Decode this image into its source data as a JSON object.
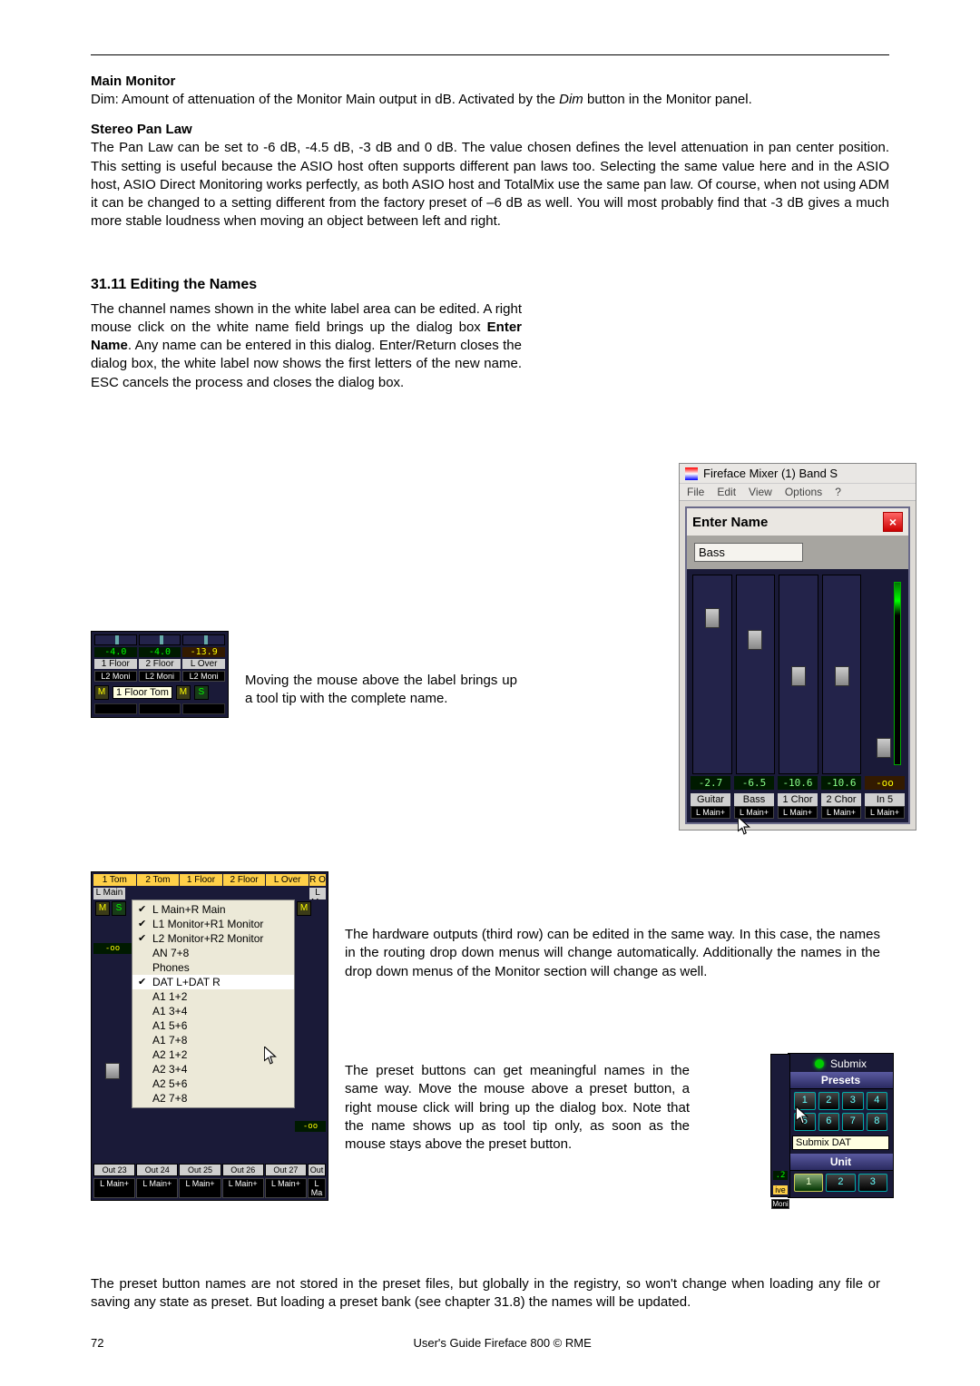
{
  "headings": {
    "main_monitor": "Main Monitor",
    "stereo_pan_law": "Stereo Pan Law",
    "editing_names": "31.11 Editing the Names"
  },
  "paragraphs": {
    "dim_pre": "Dim: Amount of attenuation of the Monitor Main output in dB. Activated by the ",
    "dim_italic": "Dim",
    "dim_post": " button in the Monitor panel.",
    "pan_law": "The Pan Law can be set to -6 dB, -4.5 dB, -3 dB and 0 dB. The value chosen defines the level attenuation in pan center position. This setting is useful because the ASIO host often supports different pan laws too. Selecting the same value here and in the ASIO host, ASIO Direct Monitoring works perfectly, as both ASIO host and TotalMix use the same pan law. Of course, when not using ADM it can be changed to a setting different from the factory preset of –6 dB as well. You will most probably find that -3 dB gives a much more stable loudness when moving an object between left and right.",
    "edit_pre": "The channel names shown in the white label area can be edited. A right mouse click on the white name field brings up the dialog box ",
    "edit_bold": "Enter Name",
    "edit_post": ". Any name can be entered in this dialog. Enter/Return closes the dialog box, the white label now shows the first letters of the new name. ESC cancels the process and closes the dialog box.",
    "tooltip": "Moving the mouse above the label brings up a tool tip with the complete name.",
    "routing": "The hardware outputs (third row) can be edited in the same way. In this case, the names in the routing drop down menus will change automatically. Additionally the names in the drop down menus of the Monitor section will change as well.",
    "presets": "The preset buttons can get meaningful names in the same way. Move the mouse above a preset button, a right mouse click will bring up the dialog box. Note that the name shows up as tool tip only, as soon as the mouse stays above the preset button.",
    "final": "The preset button names are not stored in the preset files, but globally in the registry, so won't change when loading any file or saving any state as preset. But loading a preset bank (see chapter 31.8) the names will be updated."
  },
  "enter_name_dialog": {
    "title": "Fireface Mixer (1) Band S",
    "menus": [
      "File",
      "Edit",
      "View",
      "Options",
      "?"
    ],
    "panel_title": "Enter Name",
    "input_value": "Bass",
    "db_values": [
      "-2.7",
      "-6.5",
      "-10.6",
      "-10.6",
      "-oo"
    ],
    "names": [
      "Guitar",
      "Bass",
      "1 Chor",
      "2 Chor",
      "In 5"
    ],
    "routes": [
      "L Main+",
      "L Main+",
      "L Main+",
      "L Main+",
      "L Main+"
    ]
  },
  "tooltip_fig": {
    "db_values": [
      "-4.0",
      "-4.0",
      "-13.9"
    ],
    "names": [
      "1 Floor",
      "2 Floor",
      "L Over"
    ],
    "routes": [
      "L2 Moni",
      "L2 Moni",
      "L2 Moni"
    ],
    "m": "M",
    "s": "S",
    "tip": "1 Floor Tom"
  },
  "routing_fig": {
    "top_labels": [
      "1 Tom",
      "2 Tom",
      "1 Floor",
      "2 Floor",
      "L Over",
      "R O"
    ],
    "l_main": "L Main",
    "ms": {
      "m": "M",
      "s": "S"
    },
    "oo": "-oo",
    "menu": [
      {
        "label": "L Main+R Main",
        "checked": true
      },
      {
        "label": "L1 Monitor+R1 Monitor",
        "checked": true
      },
      {
        "label": "L2 Monitor+R2 Monitor",
        "checked": true
      },
      {
        "label": "AN 7+8",
        "checked": false
      },
      {
        "label": "Phones",
        "checked": false
      },
      {
        "label": "DAT L+DAT R",
        "checked": true,
        "selected": true
      },
      {
        "label": "A1 1+2",
        "checked": false
      },
      {
        "label": "A1 3+4",
        "checked": false
      },
      {
        "label": "A1 5+6",
        "checked": false
      },
      {
        "label": "A1 7+8",
        "checked": false
      },
      {
        "label": "A2 1+2",
        "checked": false
      },
      {
        "label": "A2 3+4",
        "checked": false
      },
      {
        "label": "A2 5+6",
        "checked": false
      },
      {
        "label": "A2 7+8",
        "checked": false
      }
    ],
    "bottom_labels": [
      "Out 23",
      "Out 24",
      "Out 25",
      "Out 26",
      "Out 27",
      "Out"
    ],
    "bottom_routes": [
      "L Main+",
      "L Main+",
      "L Main+",
      "L Main+",
      "L Main+",
      "L Ma"
    ],
    "right_top": "L Ma",
    "right_m": "M"
  },
  "preset_fig": {
    "submix_h": "Submix",
    "presets_h": "Presets",
    "buttons": [
      "1",
      "2",
      "3",
      "4",
      "5",
      "6",
      "7",
      "8"
    ],
    "tooltip": "Submix DAT",
    "unit_h": "Unit",
    "units": [
      "1",
      "2",
      "3"
    ],
    "strip_db": ".2",
    "strip_name": "ive",
    "strip_route": "Moni"
  },
  "footer": {
    "page": "72",
    "text": "User's Guide Fireface 800  ©  RME"
  }
}
